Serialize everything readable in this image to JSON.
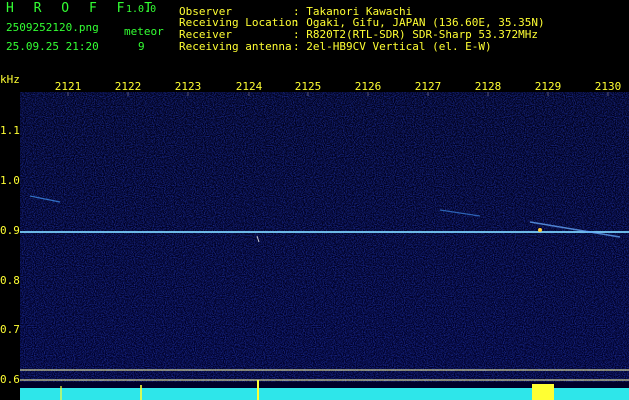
{
  "app": {
    "name": "H R O F F T",
    "version": "1.0.0"
  },
  "file": {
    "name": "2509252120.png",
    "datetime": "25.09.25 21:20"
  },
  "meteor": {
    "label": "meteor",
    "count": "9"
  },
  "station": {
    "observer_label": "Observer",
    "observer_value": ": Takanori Kawachi",
    "location_label": "Receiving Location",
    "location_value": ": Ogaki, Gifu, JAPAN (136.60E, 35.35N)",
    "receiver_label": "Receiver",
    "receiver_value": ": R820T2(RTL-SDR) SDR-Sharp 53.372MHz",
    "antenna_label": "Receiving antenna",
    "antenna_value": ": 2el-HB9CV Vertical (el. E-W)"
  },
  "axes": {
    "y_unit": "kHz",
    "x_ticks": [
      "2121",
      "2122",
      "2123",
      "2124",
      "2125",
      "2126",
      "2127",
      "2128",
      "2129",
      "2130"
    ],
    "y_ticks": [
      "1.1",
      "1.0",
      "0.9",
      "0.8",
      "0.7",
      "0.6"
    ]
  },
  "colors": {
    "background": "#000000",
    "text_green": "#33ff33",
    "text_yellow": "#ffff33",
    "accent_cyan": "#33ffff"
  }
}
